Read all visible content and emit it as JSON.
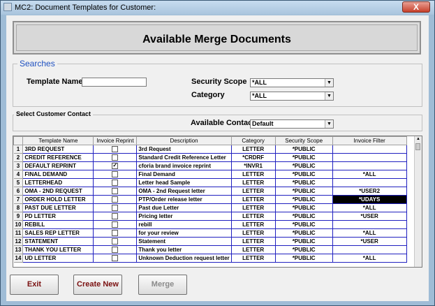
{
  "window": {
    "title": "MC2: Document Templates for Customer:",
    "close_label": "X",
    "bg_menu_ghost": "· · · ·"
  },
  "header": {
    "title": "Available Merge Documents"
  },
  "searches": {
    "legend": "Searches",
    "template_name_label": "Template Name",
    "template_name_value": "",
    "security_scope_label": "Security Scope",
    "security_scope_value": "*ALL",
    "category_label": "Category",
    "category_value": "*ALL"
  },
  "contact": {
    "legend": "Select Customer Contact",
    "available_contacts_label": "Available Contacts",
    "available_contacts_value": "Default"
  },
  "table": {
    "columns": [
      "Template Name",
      "Invoice Reprint",
      "Description",
      "Category",
      "Security Scope",
      "Invoice Filter"
    ],
    "rows": [
      {
        "n": "1",
        "name": "3RD REQUEST",
        "reprint": false,
        "desc": "3rd Request",
        "cat": "LETTER",
        "scope": "*PUBLIC",
        "filter": ""
      },
      {
        "n": "2",
        "name": "CREDIT REFERENCE",
        "reprint": false,
        "desc": "Standard Credit Reference Letter",
        "cat": "*CRDRF",
        "scope": "*PUBLIC",
        "filter": ""
      },
      {
        "n": "3",
        "name": "DEFAULT REPRINT",
        "reprint": true,
        "desc": "cforia brand invoice reprint",
        "cat": "*INVR1",
        "scope": "*PUBLIC",
        "filter": ""
      },
      {
        "n": "4",
        "name": "FINAL DEMAND",
        "reprint": false,
        "desc": "Final Demand",
        "cat": "LETTER",
        "scope": "*PUBLIC",
        "filter": "*ALL"
      },
      {
        "n": "5",
        "name": "LETTERHEAD",
        "reprint": false,
        "desc": "Letter head Sample",
        "cat": "LETTER",
        "scope": "*PUBLIC",
        "filter": ""
      },
      {
        "n": "6",
        "name": "OMA - 2ND REQUEST",
        "reprint": false,
        "desc": "OMA - 2nd Request letter",
        "cat": "LETTER",
        "scope": "*PUBLIC",
        "filter": "*USER2"
      },
      {
        "n": "7",
        "name": "ORDER HOLD LETTER",
        "reprint": false,
        "desc": "PTP/Order release letter",
        "cat": "LETTER",
        "scope": "*PUBLIC",
        "filter": "*UDAYS"
      },
      {
        "n": "8",
        "name": "PAST DUE LETTER",
        "reprint": false,
        "desc": "Past due Letter",
        "cat": "LETTER",
        "scope": "*PUBLIC",
        "filter": "*ALL"
      },
      {
        "n": "9",
        "name": "PD LETTER",
        "reprint": false,
        "desc": "Pricing letter",
        "cat": "LETTER",
        "scope": "*PUBLIC",
        "filter": "*USER"
      },
      {
        "n": "10",
        "name": "REBILL",
        "reprint": false,
        "desc": "rebill",
        "cat": "LETTER",
        "scope": "*PUBLIC",
        "filter": ""
      },
      {
        "n": "11",
        "name": "SALES REP LETTER",
        "reprint": false,
        "desc": "for your review",
        "cat": "LETTER",
        "scope": "*PUBLIC",
        "filter": "*ALL"
      },
      {
        "n": "12",
        "name": "STATEMENT",
        "reprint": false,
        "desc": "Statement",
        "cat": "LETTER",
        "scope": "*PUBLIC",
        "filter": "*USER"
      },
      {
        "n": "13",
        "name": "THANK YOU LETTER",
        "reprint": false,
        "desc": "Thank you letter",
        "cat": "LETTER",
        "scope": "*PUBLIC",
        "filter": ""
      },
      {
        "n": "14",
        "name": "UD LETTER",
        "reprint": false,
        "desc": "Unknown Deduction request letter",
        "cat": "LETTER",
        "scope": "*PUBLIC",
        "filter": "*ALL"
      }
    ]
  },
  "buttons": {
    "exit": "Exit",
    "create_new": "Create New",
    "merge": "Merge"
  },
  "icons": {
    "check": "✓",
    "dropdown": "▼",
    "scroll_up": "▲"
  },
  "colors": {
    "grid_line": "#2020c0",
    "highlight": "#000000",
    "title_bar": "#a9c4dd"
  }
}
